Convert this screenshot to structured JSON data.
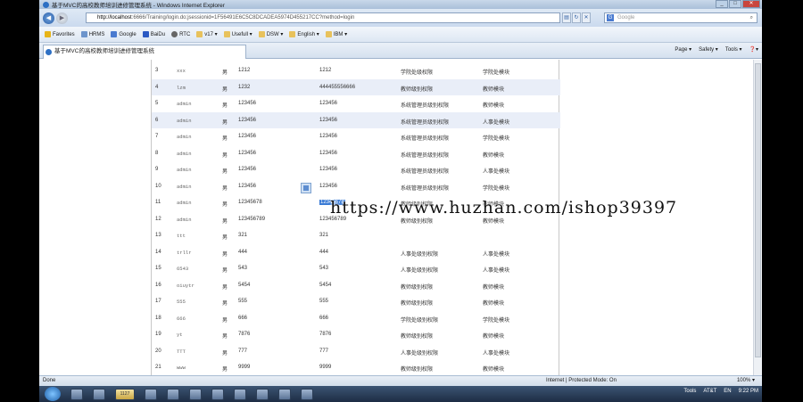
{
  "window": {
    "title": "基于MVC的高校教师培训进修管理系统 - Windows Internet Explorer",
    "controls": [
      "_",
      "□",
      "✕"
    ]
  },
  "address": {
    "url_host": "http://localhost",
    "url_rest": ":6666/Training/login.do;jsessionid=1F56491E6C5C8DCADEA5974D455217CC?method=login",
    "search_placeholder": "Google"
  },
  "favorites": [
    {
      "label": "Favorites",
      "kind": "favorites"
    },
    {
      "label": "HRMS",
      "kind": "link"
    },
    {
      "label": "Google",
      "kind": "google"
    },
    {
      "label": "BaiDu",
      "kind": "baidu"
    },
    {
      "label": "RTC",
      "kind": "rtc"
    },
    {
      "label": "v17 ▾",
      "kind": "folder"
    },
    {
      "label": "Usefull ▾",
      "kind": "folder"
    },
    {
      "label": "DSW ▾",
      "kind": "folder"
    },
    {
      "label": "English ▾",
      "kind": "folder"
    },
    {
      "label": "IBM ▾",
      "kind": "folder"
    }
  ],
  "tab": {
    "label": "基于MVC的高校教师培训进修管理系统"
  },
  "commandbar": [
    "Page ▾",
    "Safety ▾",
    "Tools ▾",
    "❓▾"
  ],
  "table": {
    "rows": [
      {
        "id": "3",
        "user": "xxx",
        "sex": "男",
        "pwd": "1212",
        "pwd2": "1212",
        "role": "学院处级权限",
        "module": "学院处模块"
      },
      {
        "id": "4",
        "user": "lzm",
        "sex": "男",
        "pwd": "1232",
        "pwd2": "444455556666",
        "role": "教师级别权限",
        "module": "教师模块"
      },
      {
        "id": "5",
        "user": "admin",
        "sex": "男",
        "pwd": "123456",
        "pwd2": "123456",
        "role": "系统管理员级别权限",
        "module": "教师模块"
      },
      {
        "id": "6",
        "user": "admin",
        "sex": "男",
        "pwd": "123456",
        "pwd2": "123456",
        "role": "系统管理员级别权限",
        "module": "人事处模块"
      },
      {
        "id": "7",
        "user": "admin",
        "sex": "男",
        "pwd": "123456",
        "pwd2": "123456",
        "role": "系统管理员级别权限",
        "module": "学院处模块"
      },
      {
        "id": "8",
        "user": "admin",
        "sex": "男",
        "pwd": "123456",
        "pwd2": "123456",
        "role": "系统管理员级别权限",
        "module": "教师模块"
      },
      {
        "id": "9",
        "user": "admin",
        "sex": "男",
        "pwd": "123456",
        "pwd2": "123456",
        "role": "系统管理员级别权限",
        "module": "人事处模块"
      },
      {
        "id": "10",
        "user": "admin",
        "sex": "男",
        "pwd": "123456",
        "pwd2": "123456",
        "role": "系统管理员级别权限",
        "module": "学院处模块"
      },
      {
        "id": "11",
        "user": "admin",
        "sex": "男",
        "pwd": "12345678",
        "pwd2": "12345678",
        "role": "教师级别权限",
        "module": "教师模块"
      },
      {
        "id": "12",
        "user": "admin",
        "sex": "男",
        "pwd": "123456789",
        "pwd2": "123456789",
        "role": "教师级别权限",
        "module": "教师模块"
      },
      {
        "id": "13",
        "user": "ttt",
        "sex": "男",
        "pwd": "321",
        "pwd2": "321",
        "role": "",
        "module": ""
      },
      {
        "id": "14",
        "user": "trllr",
        "sex": "男",
        "pwd": "444",
        "pwd2": "444",
        "role": "人事处级别权限",
        "module": "人事处模块"
      },
      {
        "id": "15",
        "user": "6543",
        "sex": "男",
        "pwd": "543",
        "pwd2": "543",
        "role": "人事处级别权限",
        "module": "人事处模块"
      },
      {
        "id": "16",
        "user": "oiuytr",
        "sex": "男",
        "pwd": "5454",
        "pwd2": "5454",
        "role": "教师级别权限",
        "module": "教师模块"
      },
      {
        "id": "17",
        "user": "555",
        "sex": "男",
        "pwd": "555",
        "pwd2": "555",
        "role": "教师级别权限",
        "module": "教师模块"
      },
      {
        "id": "18",
        "user": "666",
        "sex": "男",
        "pwd": "666",
        "pwd2": "666",
        "role": "学院处级别权限",
        "module": "学院处模块"
      },
      {
        "id": "19",
        "user": "yt",
        "sex": "男",
        "pwd": "7876",
        "pwd2": "7876",
        "role": "教师级别权限",
        "module": "教师模块"
      },
      {
        "id": "20",
        "user": "TTT",
        "sex": "男",
        "pwd": "777",
        "pwd2": "777",
        "role": "人事处级别权限",
        "module": "人事处模块"
      },
      {
        "id": "21",
        "user": "www",
        "sex": "男",
        "pwd": "9999",
        "pwd2": "9999",
        "role": "教师级别权限",
        "module": "教师模块"
      }
    ],
    "highlighted_rows": [
      1,
      3
    ],
    "selected_text_row": 8
  },
  "watermark": "https://www.huzhan.com/ishop39397",
  "status": {
    "left": "Done",
    "zone": "Internet | Protected Mode: On",
    "zoom": "100% ▾"
  },
  "taskbar": {
    "active_label": "1127",
    "tray": [
      "Tools",
      "AT&T",
      "EN",
      "9:22 PM"
    ]
  }
}
